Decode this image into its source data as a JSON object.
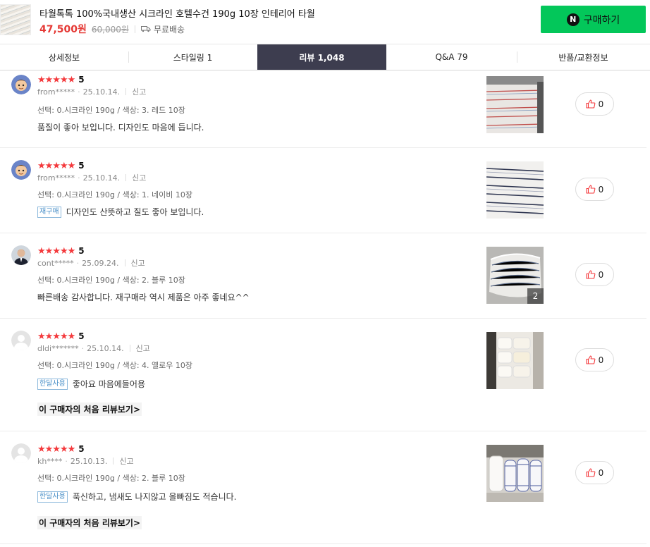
{
  "header": {
    "product_title": "타월톡톡 100%국내생산 시크라인 호텔수건 190g 10장 인테리어 타월",
    "price": "47,500원",
    "original_price": "60,000원",
    "shipping": "무료배송",
    "buy_button": "구매하기",
    "naver_logo": "N"
  },
  "tabs": [
    {
      "label": "상세정보",
      "active": false
    },
    {
      "label": "스타일링 1",
      "active": false
    },
    {
      "label": "리뷰 1,048",
      "active": true
    },
    {
      "label": "Q&A 79",
      "active": false
    },
    {
      "label": "반품/교환정보",
      "active": false
    }
  ],
  "reviews": [
    {
      "stars": "★★★★★",
      "score": "5",
      "author": "from*****",
      "date": "25.10.14.",
      "report": "신고",
      "option": "선택: 0.시크라인 190g / 색상: 3. 레드 10장",
      "tag": "",
      "text": "품질이 좋아 보입니다. 디자인도 마음에 듭니다.",
      "first_review_link": "",
      "photo_count": "",
      "likes": "0",
      "avatar": "cartoon-avatar",
      "photo": "red-stripe-towel"
    },
    {
      "stars": "★★★★★",
      "score": "5",
      "author": "from*****",
      "date": "25.10.14.",
      "report": "신고",
      "option": "선택: 0.시크라인 190g / 색상: 1. 네이비 10장",
      "tag": "재구매",
      "text": "디자인도 산뜻하고 질도 좋아 보입니다.",
      "first_review_link": "",
      "photo_count": "",
      "likes": "0",
      "avatar": "cartoon-avatar",
      "photo": "navy-stripe-towel"
    },
    {
      "stars": "★★★★★",
      "score": "5",
      "author": "cont*****",
      "date": "25.09.24.",
      "report": "신고",
      "option": "선택: 0.시크라인 190g / 색상: 2. 블루 10장",
      "tag": "",
      "text": "빠른배송 감사합니다. 재구매라 역시 제품은 아주 좋네요^^",
      "first_review_link": "",
      "photo_count": "2",
      "likes": "0",
      "avatar": "photo-avatar",
      "photo": "packaged-towels"
    },
    {
      "stars": "★★★★★",
      "score": "5",
      "author": "dldi*******",
      "date": "25.10.14.",
      "report": "신고",
      "option": "선택: 0.시크라인 190g / 색상: 4. 옐로우 10장",
      "tag": "한달사용",
      "text": "좋아요 마음에들어용",
      "first_review_link": "이 구매자의 처음 리뷰보기>",
      "photo_count": "",
      "likes": "0",
      "avatar": "default-avatar",
      "photo": "towels-on-shelf"
    },
    {
      "stars": "★★★★★",
      "score": "5",
      "author": "kh****",
      "date": "25.10.13.",
      "report": "신고",
      "option": "선택: 0.시크라인 190g / 색상: 2. 블루 10장",
      "tag": "한달사용",
      "text": "푹신하고, 냄새도 나지않고 올빠짐도 적습니다.",
      "first_review_link": "이 구매자의 처음 리뷰보기>",
      "photo_count": "",
      "likes": "0",
      "avatar": "default-avatar",
      "photo": "rolled-towels"
    }
  ],
  "colors": {
    "accent_red": "#f4393c",
    "buy_green": "#03c75a",
    "active_tab": "#3d3d4f",
    "tag_blue": "#4a90c8"
  }
}
